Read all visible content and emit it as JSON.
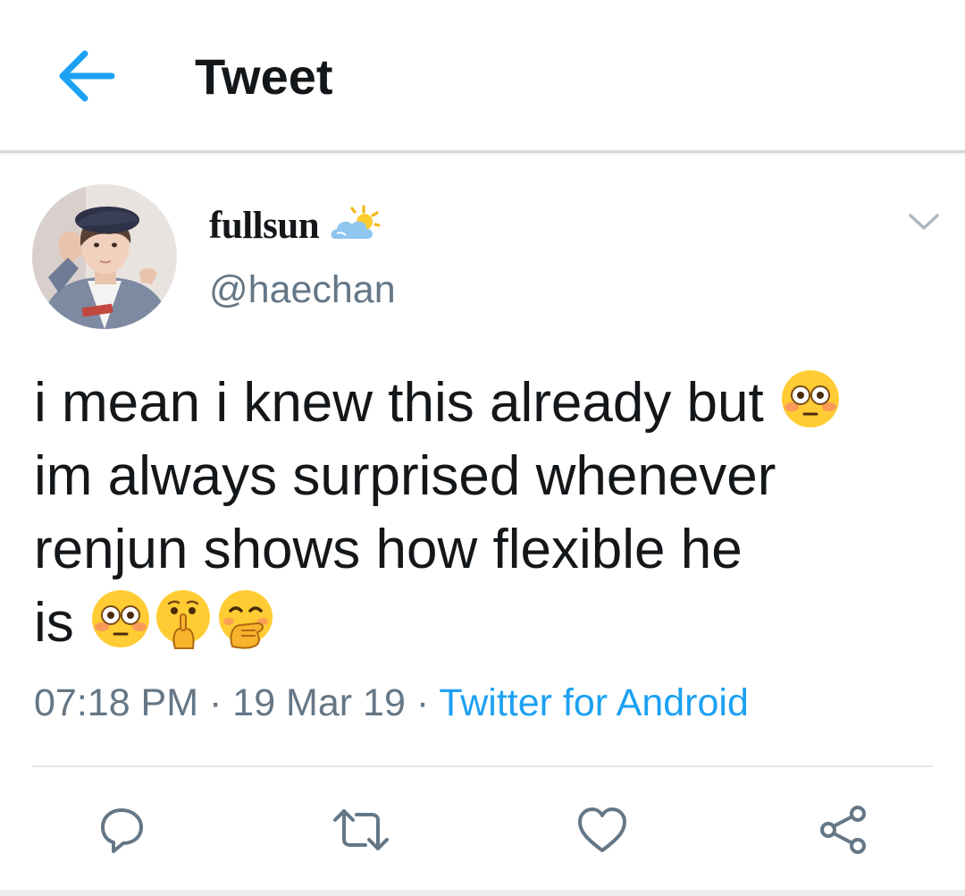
{
  "header": {
    "title": "Tweet",
    "back_icon": "arrow-left-icon",
    "accent_color": "#1da1f2"
  },
  "tweet": {
    "author": {
      "display_name": "fullsun",
      "name_emoji": "sun-behind-cloud-emoji",
      "handle": "@haechan",
      "avatar_icon": "profile-photo"
    },
    "more_icon": "chevron-down-icon",
    "text_lines": [
      "i mean i knew this already but",
      "im always surprised whenever",
      "renjun shows how flexible he",
      "is"
    ],
    "emojis": [
      "flushed-face",
      "flushed-face",
      "shushing-face",
      "face-with-hand-over-mouth"
    ],
    "time": "07:18 PM",
    "sep1": " · ",
    "date": "19 Mar 19",
    "sep2": " · ",
    "source": "Twitter for Android"
  },
  "actions": {
    "reply_icon": "reply-icon",
    "retweet_icon": "retweet-icon",
    "like_icon": "heart-icon",
    "share_icon": "share-icon",
    "icon_color": "#657786"
  }
}
